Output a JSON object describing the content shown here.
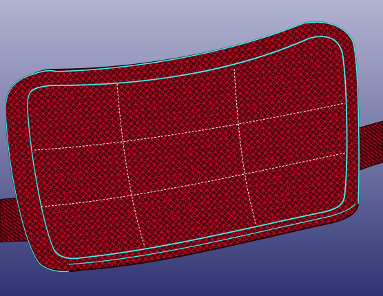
{
  "viewport": {
    "background_top": "#b2b3d0",
    "background_bottom": "#2f3473"
  },
  "model": {
    "mesh_color": "#c8102e",
    "mesh_dark": "#4a0008",
    "edge_color": "#3ef0f0",
    "feature_line_color": "#ffffff"
  }
}
